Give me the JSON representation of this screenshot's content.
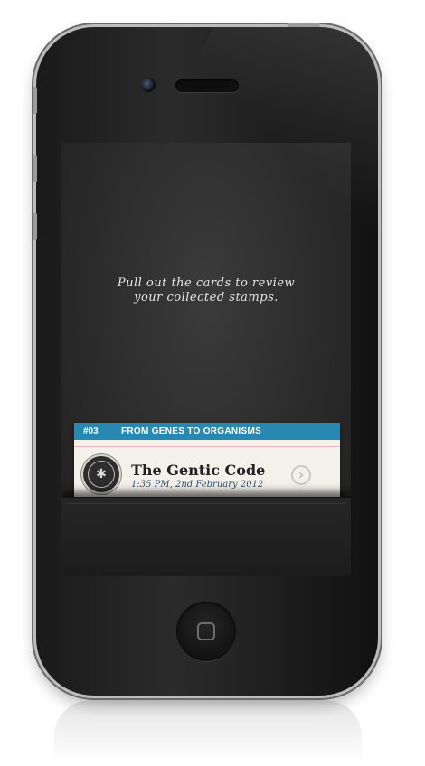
{
  "screen": {
    "hint_line1": "Pull out the cards to review",
    "hint_line2": "your collected stamps."
  },
  "card": {
    "number": "#03",
    "category": "FROM GENES TO ORGANISMS",
    "title": "The Gentic Code",
    "timestamp": "1:35 PM, 2nd February 2012",
    "accent_color": "#2a88b0"
  },
  "icons": {
    "stamp": "dna-stamp-icon",
    "chevron": "chevron-right-circle-icon",
    "home": "home-button-icon"
  }
}
